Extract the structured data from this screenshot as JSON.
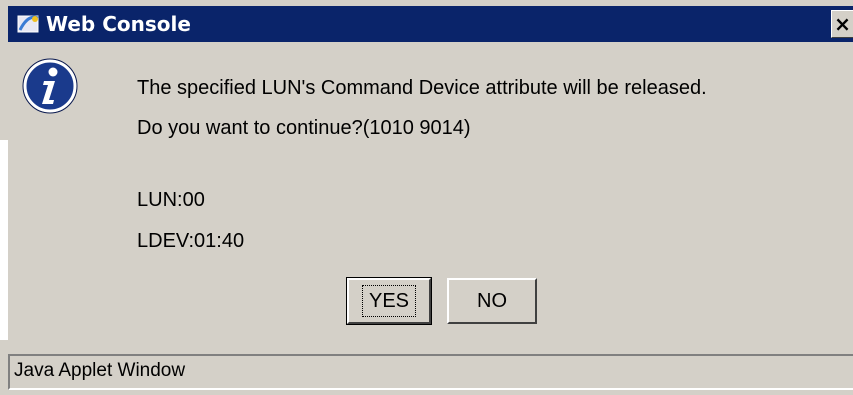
{
  "window": {
    "title": "Web Console",
    "close_label": "×",
    "title_icon": "java-applet-icon"
  },
  "message": {
    "icon": "info-icon",
    "line1": "The specified LUN's Command Device attribute will be released.",
    "line2": "Do you want to continue?(1010 9014)",
    "lun": "LUN:00",
    "ldev": "LDEV:01:40"
  },
  "buttons": {
    "yes_label": "YES",
    "no_label": "NO"
  },
  "status": {
    "text": "Java Applet Window"
  },
  "colors": {
    "titlebar": "#0a246a",
    "dialog": "#d4d0c8",
    "info_icon": "#1a3a8c"
  }
}
